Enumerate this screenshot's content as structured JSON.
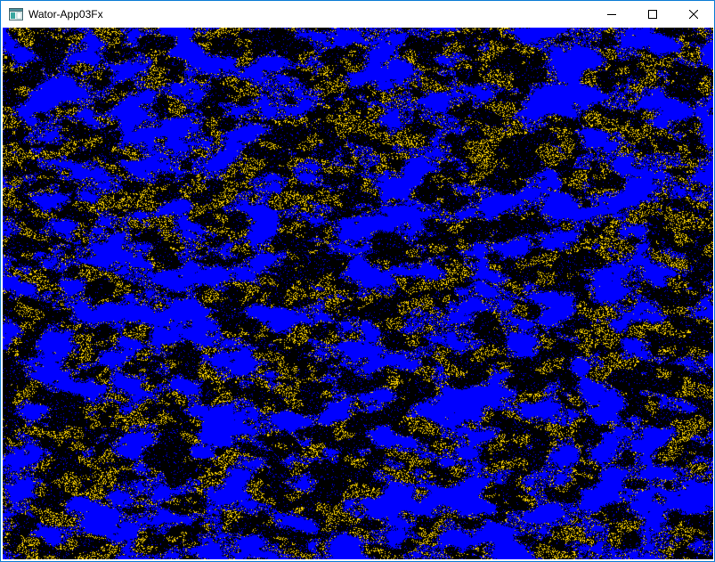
{
  "window": {
    "title": "Wator-App03Fx",
    "icon": "app-window-icon",
    "controls": {
      "minimize": "minimize-icon",
      "maximize": "maximize-icon",
      "close": "close-icon"
    }
  },
  "simulation": {
    "description_colors": {
      "ocean": "#000000",
      "fish": "#0000ff",
      "shark": "#ffd700"
    },
    "accent_border": "#1883d7"
  }
}
